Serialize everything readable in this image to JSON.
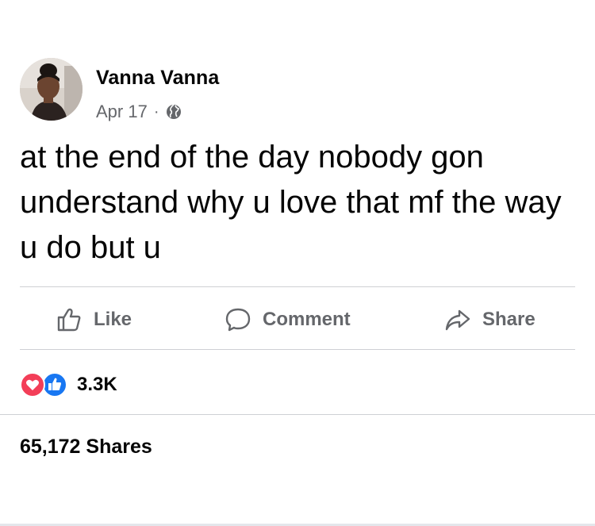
{
  "post": {
    "author": "Vanna Vanna",
    "date": "Apr 17",
    "separator": "·",
    "privacy_icon": "globe-icon",
    "text": "at the end of the day nobody gon understand why u love that mf the way u do but u"
  },
  "actions": {
    "like_label": "Like",
    "comment_label": "Comment",
    "share_label": "Share"
  },
  "reactions": {
    "types": [
      "love",
      "like"
    ],
    "count": "3.3K"
  },
  "shares": {
    "label": "65,172 Shares"
  },
  "colors": {
    "text": "#050505",
    "muted": "#65676b",
    "divider": "#ced0d4",
    "love": "#f33e58",
    "like": "#1877f2"
  }
}
